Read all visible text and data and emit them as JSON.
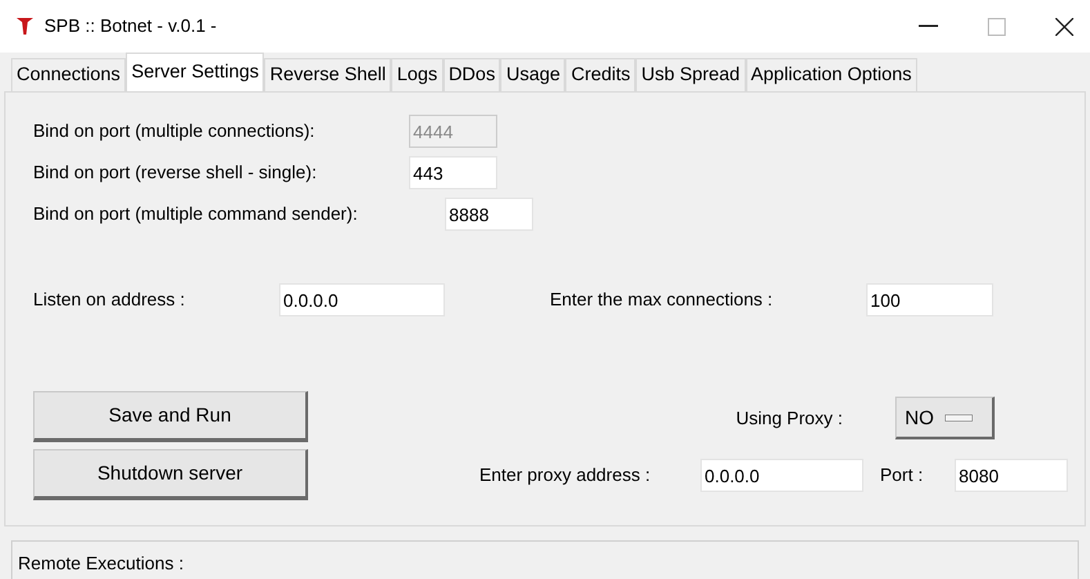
{
  "window": {
    "title": "SPB :: Botnet - v.0.1 -"
  },
  "tabs": [
    {
      "label": "Connections",
      "selected": false
    },
    {
      "label": "Server Settings",
      "selected": true
    },
    {
      "label": "Reverse Shell",
      "selected": false
    },
    {
      "label": "Logs",
      "selected": false
    },
    {
      "label": "DDos",
      "selected": false
    },
    {
      "label": "Usage",
      "selected": false
    },
    {
      "label": "Credits",
      "selected": false
    },
    {
      "label": "Usb Spread",
      "selected": false
    },
    {
      "label": "Application Options",
      "selected": false
    }
  ],
  "ports": [
    {
      "label": "Bind on port (multiple connections):",
      "value": "4444",
      "disabled": true
    },
    {
      "label": "Bind on port (reverse shell - single):",
      "value": "443",
      "disabled": false
    },
    {
      "label": "Bind on port (multiple command sender):",
      "value": "8888",
      "disabled": false
    }
  ],
  "listen": {
    "label": "Listen on address :",
    "value": "0.0.0.0"
  },
  "max_connections": {
    "label": "Enter the max connections :",
    "value": "100"
  },
  "buttons": [
    "Save and Run",
    "Shutdown server"
  ],
  "proxy": {
    "label": "Using Proxy :",
    "value": "NO",
    "address_label": "Enter proxy address :",
    "address": "0.0.0.0",
    "port_label": "Port :",
    "port": "8080"
  },
  "bottom_panel": {
    "label": "Remote Executions :"
  }
}
